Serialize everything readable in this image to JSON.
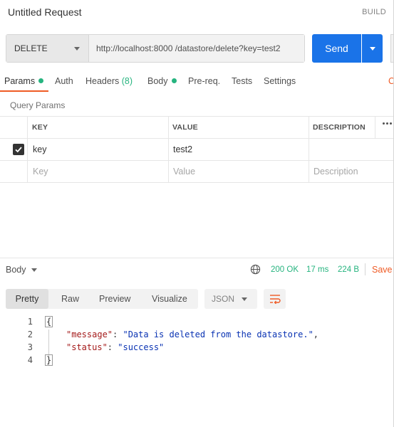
{
  "header": {
    "title": "Untitled Request",
    "build_label": "BUILD"
  },
  "request": {
    "method": "DELETE",
    "url": "http://localhost:8000 /datastore/delete?key=test2",
    "send_label": "Send"
  },
  "tabs": [
    {
      "label": "Params",
      "active": true,
      "dot": true
    },
    {
      "label": "Auth"
    },
    {
      "label": "Headers",
      "count": "(8)"
    },
    {
      "label": "Body",
      "dot": true
    },
    {
      "label": "Pre-req."
    },
    {
      "label": "Tests"
    },
    {
      "label": "Settings"
    },
    {
      "label": "C"
    }
  ],
  "query_params": {
    "title": "Query Params",
    "columns": [
      "KEY",
      "VALUE",
      "DESCRIPTION"
    ],
    "rows": [
      {
        "checked": true,
        "key": "key",
        "value": "test2",
        "description": ""
      }
    ],
    "placeholder": {
      "key": "Key",
      "value": "Value",
      "description": "Description"
    }
  },
  "response": {
    "body_label": "Body",
    "status": "200 OK",
    "time": "17 ms",
    "size": "224 B",
    "save_label": "Save",
    "views": [
      "Pretty",
      "Raw",
      "Preview",
      "Visualize"
    ],
    "active_view": "Pretty",
    "format": "JSON",
    "code_lines": [
      {
        "num": "1",
        "text": "{"
      },
      {
        "num": "2",
        "key": "\"message\"",
        "sep": ": ",
        "val": "\"Data is deleted from the datastore.\"",
        "end": ","
      },
      {
        "num": "3",
        "key": "\"status\"",
        "sep": ": ",
        "val": "\"success\"",
        "end": ""
      },
      {
        "num": "4",
        "text": "}"
      }
    ]
  },
  "colors": {
    "accent": "#ef5b25",
    "primary": "#1a73e8",
    "success": "#26b47f"
  }
}
